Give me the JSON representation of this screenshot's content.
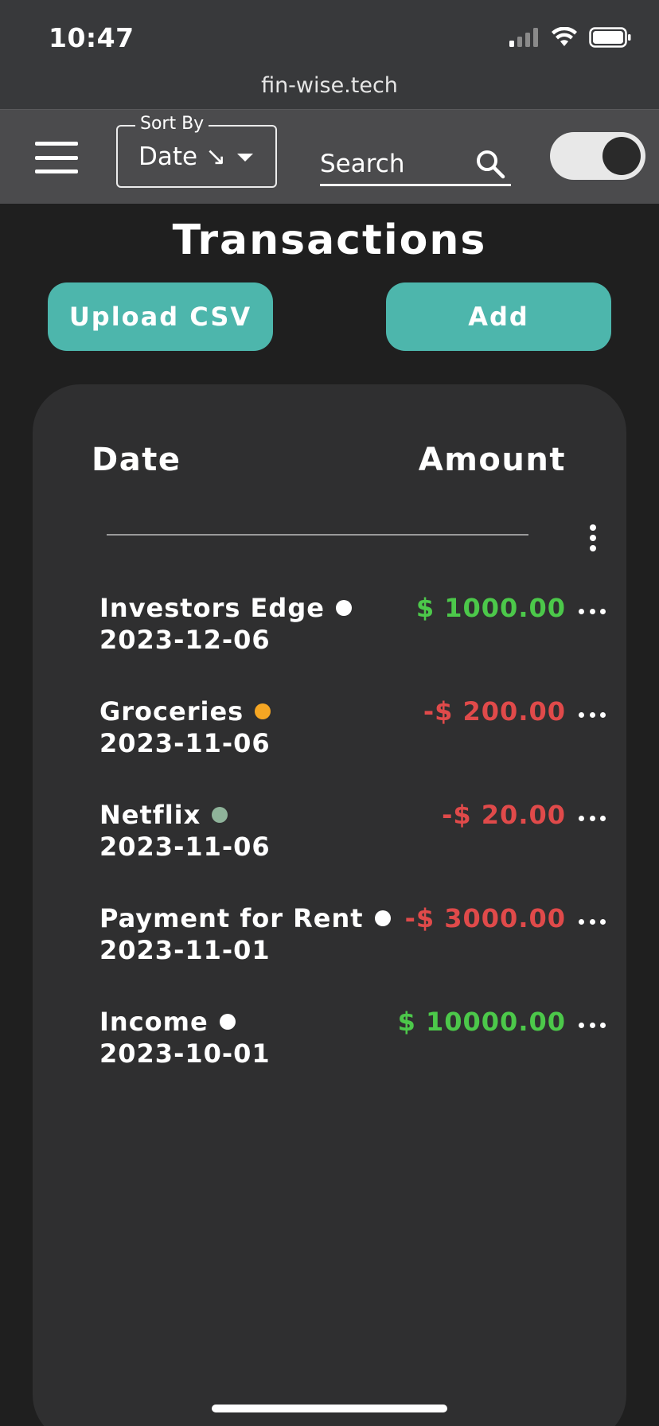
{
  "status_bar": {
    "time": "10:47",
    "icons": [
      "signal-icon",
      "wifi-icon",
      "battery-icon"
    ]
  },
  "browser": {
    "url": "fin-wise.tech"
  },
  "header": {
    "menu_icon": "hamburger-menu-icon",
    "sort": {
      "label": "Sort By",
      "value": "Date ↘"
    },
    "search": {
      "placeholder": "Search"
    },
    "theme_toggle": {
      "state": "on"
    }
  },
  "page": {
    "title": "Transactions",
    "upload_label": "Upload CSV",
    "add_label": "Add"
  },
  "table": {
    "columns": {
      "date": "Date",
      "amount": "Amount"
    },
    "rows": [
      {
        "name": "Investors Edge",
        "date": "2023-12-06",
        "amount": "$ 1000.00",
        "dot_color": "#ffffff",
        "amount_color": "#4cc84a"
      },
      {
        "name": "Groceries",
        "date": "2023-11-06",
        "amount": "-$ 200.00",
        "dot_color": "#f5a623",
        "amount_color": "#e04a4a"
      },
      {
        "name": "Netflix",
        "date": "2023-11-06",
        "amount": "-$ 20.00",
        "dot_color": "#8fb39a",
        "amount_color": "#e04a4a"
      },
      {
        "name": "Payment for Rent",
        "date": "2023-11-01",
        "amount": "-$ 3000.00",
        "dot_color": "#ffffff",
        "amount_color": "#e04a4a"
      },
      {
        "name": "Income",
        "date": "2023-10-01",
        "amount": "$ 10000.00",
        "dot_color": "#ffffff",
        "amount_color": "#4cc84a"
      }
    ]
  },
  "colors": {
    "accent": "#4db6ac",
    "positive": "#4cc84a",
    "negative": "#e04a4a",
    "panel": "#2f2f30",
    "header": "#4b4b4d"
  }
}
